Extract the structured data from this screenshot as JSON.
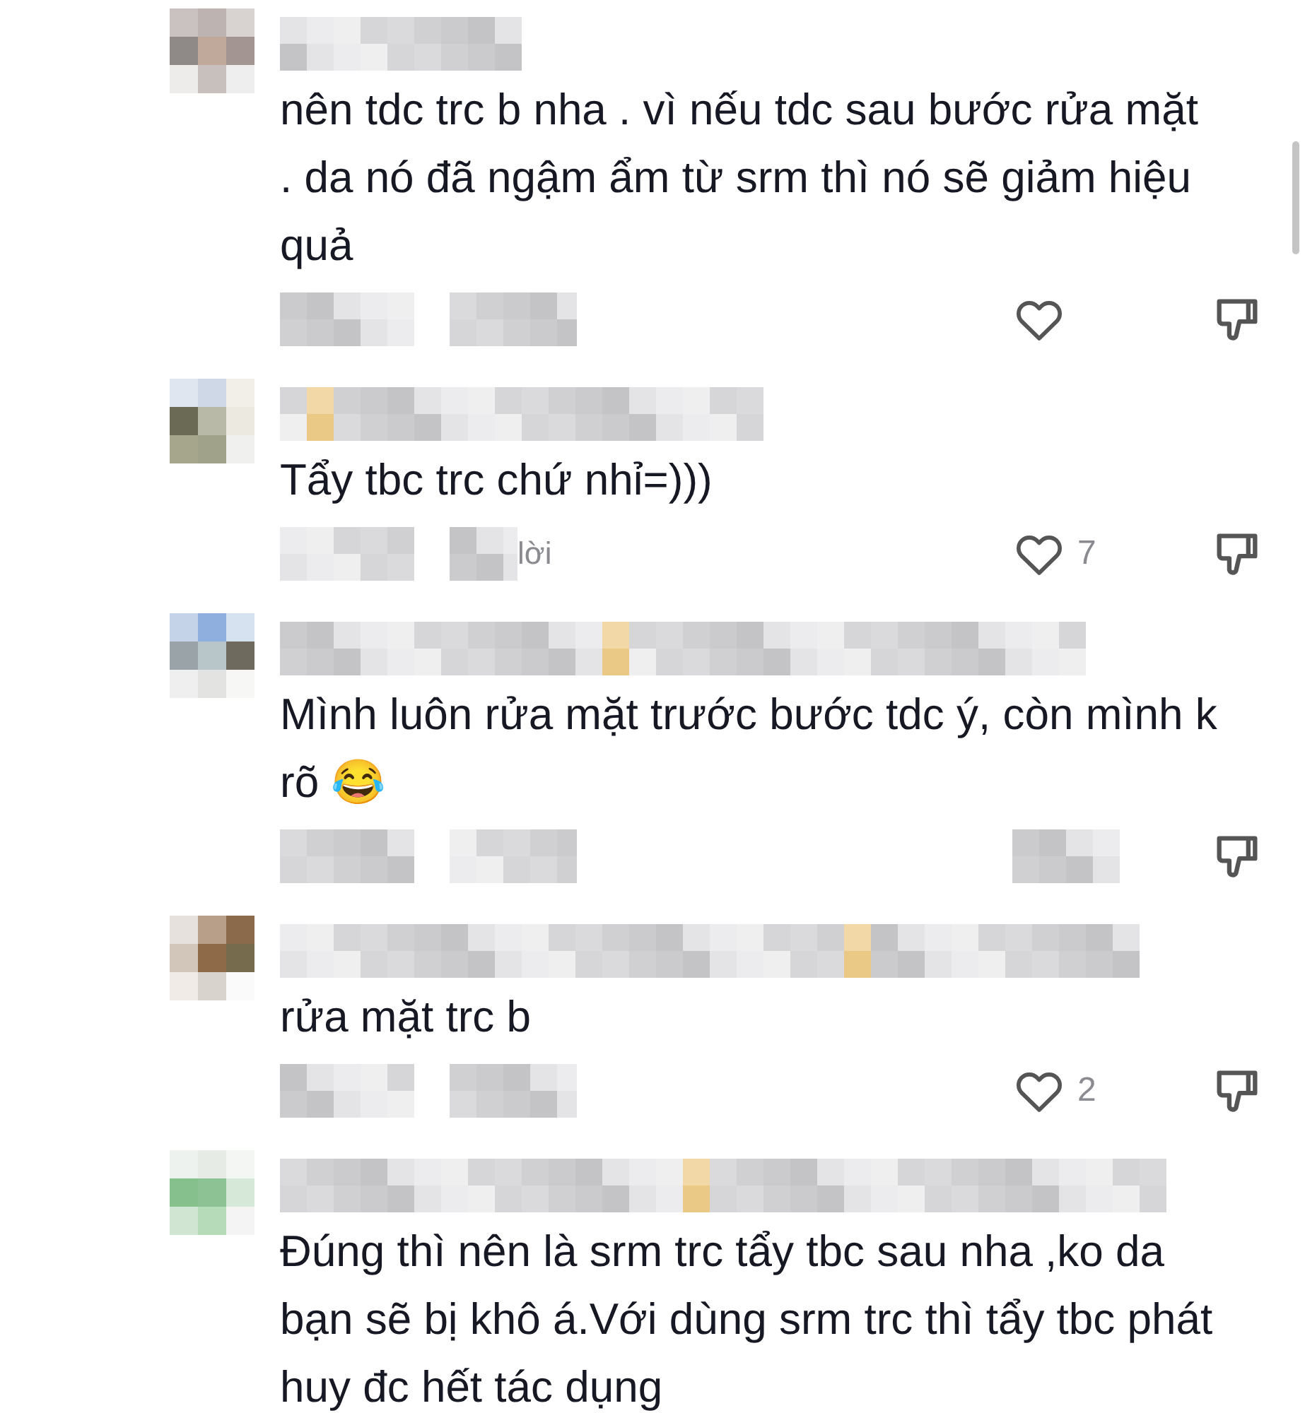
{
  "comments": [
    {
      "text": "nên tdc trc b nha . vì nếu tdc sau bước rửa mặt . da nó đã ngậm ẩm từ srm thì nó sẽ giảm hiệu quả",
      "heart": true
    },
    {
      "text": "Tẩy tbc trc chứ nhỉ=)))",
      "reply": "lời",
      "heart": true,
      "likes": "7"
    },
    {
      "text": "Mình luôn rửa mặt trước bước tdc ý, còn mình k rõ 😂",
      "heart": false
    },
    {
      "text": "rửa mặt trc b",
      "heart": true,
      "likes": "2"
    },
    {
      "text": "Đúng thì nên là srm trc tẩy tbc sau nha ,ko da bạn sẽ bị khô á.Với dùng srm trc thì tẩy tbc phát huy đc hết tác dụng"
    }
  ]
}
